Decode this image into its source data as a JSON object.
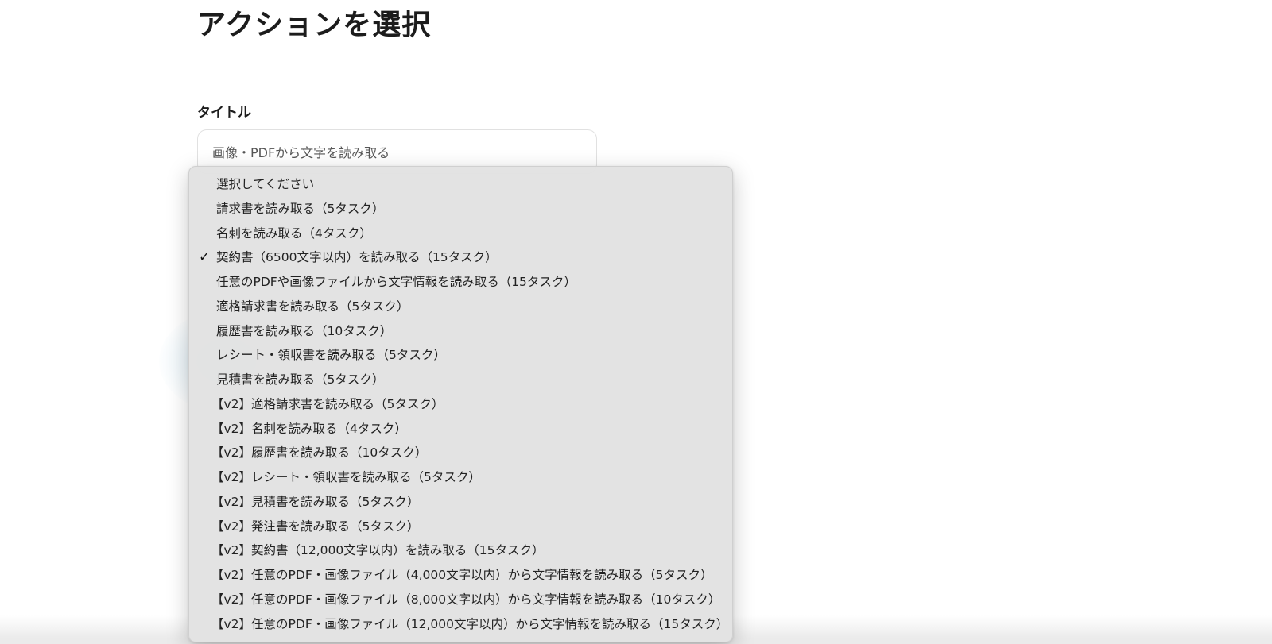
{
  "page_title": "アクションを選択",
  "title_field": {
    "label": "タイトル",
    "value": "画像・PDFから文字を読み取る"
  },
  "action_dropdown": {
    "selected_index": 3,
    "check_glyph": "✓",
    "options": [
      "選択してください",
      "請求書を読み取る（5タスク）",
      "名刺を読み取る（4タスク）",
      "契約書（6500文字以内）を読み取る（15タスク）",
      "任意のPDFや画像ファイルから文字情報を読み取る（15タスク）",
      "適格請求書を読み取る（5タスク）",
      "履歴書を読み取る（10タスク）",
      "レシート・領収書を読み取る（5タスク）",
      "見積書を読み取る（5タスク）",
      "【v2】適格請求書を読み取る（5タスク）",
      "【v2】名刺を読み取る（4タスク）",
      "【v2】履歴書を読み取る（10タスク）",
      "【v2】レシート・領収書を読み取る（5タスク）",
      "【v2】見積書を読み取る（5タスク）",
      "【v2】発注書を読み取る（5タスク）",
      "【v2】契約書（12,000文字以内）を読み取る（15タスク）",
      "【v2】任意のPDF・画像ファイル（4,000文字以内）から文字情報を読み取る（5タスク）",
      "【v2】任意のPDF・画像ファイル（8,000文字以内）から文字情報を読み取る（10タスク）",
      "【v2】任意のPDF・画像ファイル（12,000文字以内）から文字情報を読み取る（15タスク）"
    ]
  }
}
